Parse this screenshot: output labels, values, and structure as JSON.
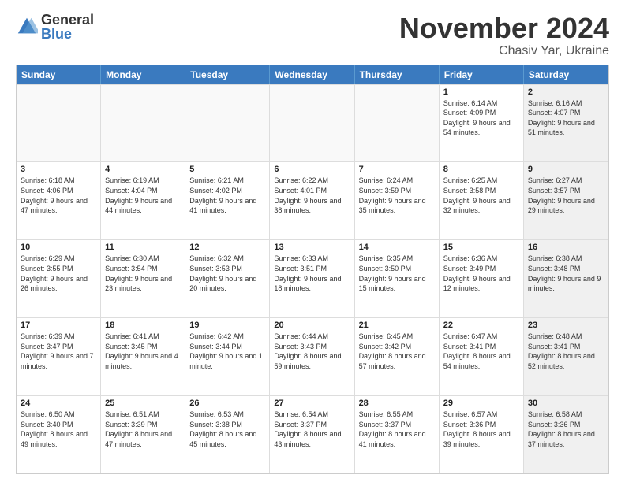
{
  "logo": {
    "general": "General",
    "blue": "Blue"
  },
  "header": {
    "month": "November 2024",
    "location": "Chasiv Yar, Ukraine"
  },
  "weekdays": [
    "Sunday",
    "Monday",
    "Tuesday",
    "Wednesday",
    "Thursday",
    "Friday",
    "Saturday"
  ],
  "rows": [
    [
      {
        "day": "",
        "sunrise": "",
        "sunset": "",
        "daylight": "",
        "empty": true
      },
      {
        "day": "",
        "sunrise": "",
        "sunset": "",
        "daylight": "",
        "empty": true
      },
      {
        "day": "",
        "sunrise": "",
        "sunset": "",
        "daylight": "",
        "empty": true
      },
      {
        "day": "",
        "sunrise": "",
        "sunset": "",
        "daylight": "",
        "empty": true
      },
      {
        "day": "",
        "sunrise": "",
        "sunset": "",
        "daylight": "",
        "empty": true
      },
      {
        "day": "1",
        "sunrise": "Sunrise: 6:14 AM",
        "sunset": "Sunset: 4:09 PM",
        "daylight": "Daylight: 9 hours and 54 minutes.",
        "empty": false,
        "shaded": false
      },
      {
        "day": "2",
        "sunrise": "Sunrise: 6:16 AM",
        "sunset": "Sunset: 4:07 PM",
        "daylight": "Daylight: 9 hours and 51 minutes.",
        "empty": false,
        "shaded": true
      }
    ],
    [
      {
        "day": "3",
        "sunrise": "Sunrise: 6:18 AM",
        "sunset": "Sunset: 4:06 PM",
        "daylight": "Daylight: 9 hours and 47 minutes.",
        "empty": false,
        "shaded": false
      },
      {
        "day": "4",
        "sunrise": "Sunrise: 6:19 AM",
        "sunset": "Sunset: 4:04 PM",
        "daylight": "Daylight: 9 hours and 44 minutes.",
        "empty": false,
        "shaded": false
      },
      {
        "day": "5",
        "sunrise": "Sunrise: 6:21 AM",
        "sunset": "Sunset: 4:02 PM",
        "daylight": "Daylight: 9 hours and 41 minutes.",
        "empty": false,
        "shaded": false
      },
      {
        "day": "6",
        "sunrise": "Sunrise: 6:22 AM",
        "sunset": "Sunset: 4:01 PM",
        "daylight": "Daylight: 9 hours and 38 minutes.",
        "empty": false,
        "shaded": false
      },
      {
        "day": "7",
        "sunrise": "Sunrise: 6:24 AM",
        "sunset": "Sunset: 3:59 PM",
        "daylight": "Daylight: 9 hours and 35 minutes.",
        "empty": false,
        "shaded": false
      },
      {
        "day": "8",
        "sunrise": "Sunrise: 6:25 AM",
        "sunset": "Sunset: 3:58 PM",
        "daylight": "Daylight: 9 hours and 32 minutes.",
        "empty": false,
        "shaded": false
      },
      {
        "day": "9",
        "sunrise": "Sunrise: 6:27 AM",
        "sunset": "Sunset: 3:57 PM",
        "daylight": "Daylight: 9 hours and 29 minutes.",
        "empty": false,
        "shaded": true
      }
    ],
    [
      {
        "day": "10",
        "sunrise": "Sunrise: 6:29 AM",
        "sunset": "Sunset: 3:55 PM",
        "daylight": "Daylight: 9 hours and 26 minutes.",
        "empty": false,
        "shaded": false
      },
      {
        "day": "11",
        "sunrise": "Sunrise: 6:30 AM",
        "sunset": "Sunset: 3:54 PM",
        "daylight": "Daylight: 9 hours and 23 minutes.",
        "empty": false,
        "shaded": false
      },
      {
        "day": "12",
        "sunrise": "Sunrise: 6:32 AM",
        "sunset": "Sunset: 3:53 PM",
        "daylight": "Daylight: 9 hours and 20 minutes.",
        "empty": false,
        "shaded": false
      },
      {
        "day": "13",
        "sunrise": "Sunrise: 6:33 AM",
        "sunset": "Sunset: 3:51 PM",
        "daylight": "Daylight: 9 hours and 18 minutes.",
        "empty": false,
        "shaded": false
      },
      {
        "day": "14",
        "sunrise": "Sunrise: 6:35 AM",
        "sunset": "Sunset: 3:50 PM",
        "daylight": "Daylight: 9 hours and 15 minutes.",
        "empty": false,
        "shaded": false
      },
      {
        "day": "15",
        "sunrise": "Sunrise: 6:36 AM",
        "sunset": "Sunset: 3:49 PM",
        "daylight": "Daylight: 9 hours and 12 minutes.",
        "empty": false,
        "shaded": false
      },
      {
        "day": "16",
        "sunrise": "Sunrise: 6:38 AM",
        "sunset": "Sunset: 3:48 PM",
        "daylight": "Daylight: 9 hours and 9 minutes.",
        "empty": false,
        "shaded": true
      }
    ],
    [
      {
        "day": "17",
        "sunrise": "Sunrise: 6:39 AM",
        "sunset": "Sunset: 3:47 PM",
        "daylight": "Daylight: 9 hours and 7 minutes.",
        "empty": false,
        "shaded": false
      },
      {
        "day": "18",
        "sunrise": "Sunrise: 6:41 AM",
        "sunset": "Sunset: 3:45 PM",
        "daylight": "Daylight: 9 hours and 4 minutes.",
        "empty": false,
        "shaded": false
      },
      {
        "day": "19",
        "sunrise": "Sunrise: 6:42 AM",
        "sunset": "Sunset: 3:44 PM",
        "daylight": "Daylight: 9 hours and 1 minute.",
        "empty": false,
        "shaded": false
      },
      {
        "day": "20",
        "sunrise": "Sunrise: 6:44 AM",
        "sunset": "Sunset: 3:43 PM",
        "daylight": "Daylight: 8 hours and 59 minutes.",
        "empty": false,
        "shaded": false
      },
      {
        "day": "21",
        "sunrise": "Sunrise: 6:45 AM",
        "sunset": "Sunset: 3:42 PM",
        "daylight": "Daylight: 8 hours and 57 minutes.",
        "empty": false,
        "shaded": false
      },
      {
        "day": "22",
        "sunrise": "Sunrise: 6:47 AM",
        "sunset": "Sunset: 3:41 PM",
        "daylight": "Daylight: 8 hours and 54 minutes.",
        "empty": false,
        "shaded": false
      },
      {
        "day": "23",
        "sunrise": "Sunrise: 6:48 AM",
        "sunset": "Sunset: 3:41 PM",
        "daylight": "Daylight: 8 hours and 52 minutes.",
        "empty": false,
        "shaded": true
      }
    ],
    [
      {
        "day": "24",
        "sunrise": "Sunrise: 6:50 AM",
        "sunset": "Sunset: 3:40 PM",
        "daylight": "Daylight: 8 hours and 49 minutes.",
        "empty": false,
        "shaded": false
      },
      {
        "day": "25",
        "sunrise": "Sunrise: 6:51 AM",
        "sunset": "Sunset: 3:39 PM",
        "daylight": "Daylight: 8 hours and 47 minutes.",
        "empty": false,
        "shaded": false
      },
      {
        "day": "26",
        "sunrise": "Sunrise: 6:53 AM",
        "sunset": "Sunset: 3:38 PM",
        "daylight": "Daylight: 8 hours and 45 minutes.",
        "empty": false,
        "shaded": false
      },
      {
        "day": "27",
        "sunrise": "Sunrise: 6:54 AM",
        "sunset": "Sunset: 3:37 PM",
        "daylight": "Daylight: 8 hours and 43 minutes.",
        "empty": false,
        "shaded": false
      },
      {
        "day": "28",
        "sunrise": "Sunrise: 6:55 AM",
        "sunset": "Sunset: 3:37 PM",
        "daylight": "Daylight: 8 hours and 41 minutes.",
        "empty": false,
        "shaded": false
      },
      {
        "day": "29",
        "sunrise": "Sunrise: 6:57 AM",
        "sunset": "Sunset: 3:36 PM",
        "daylight": "Daylight: 8 hours and 39 minutes.",
        "empty": false,
        "shaded": false
      },
      {
        "day": "30",
        "sunrise": "Sunrise: 6:58 AM",
        "sunset": "Sunset: 3:36 PM",
        "daylight": "Daylight: 8 hours and 37 minutes.",
        "empty": false,
        "shaded": true
      }
    ]
  ]
}
